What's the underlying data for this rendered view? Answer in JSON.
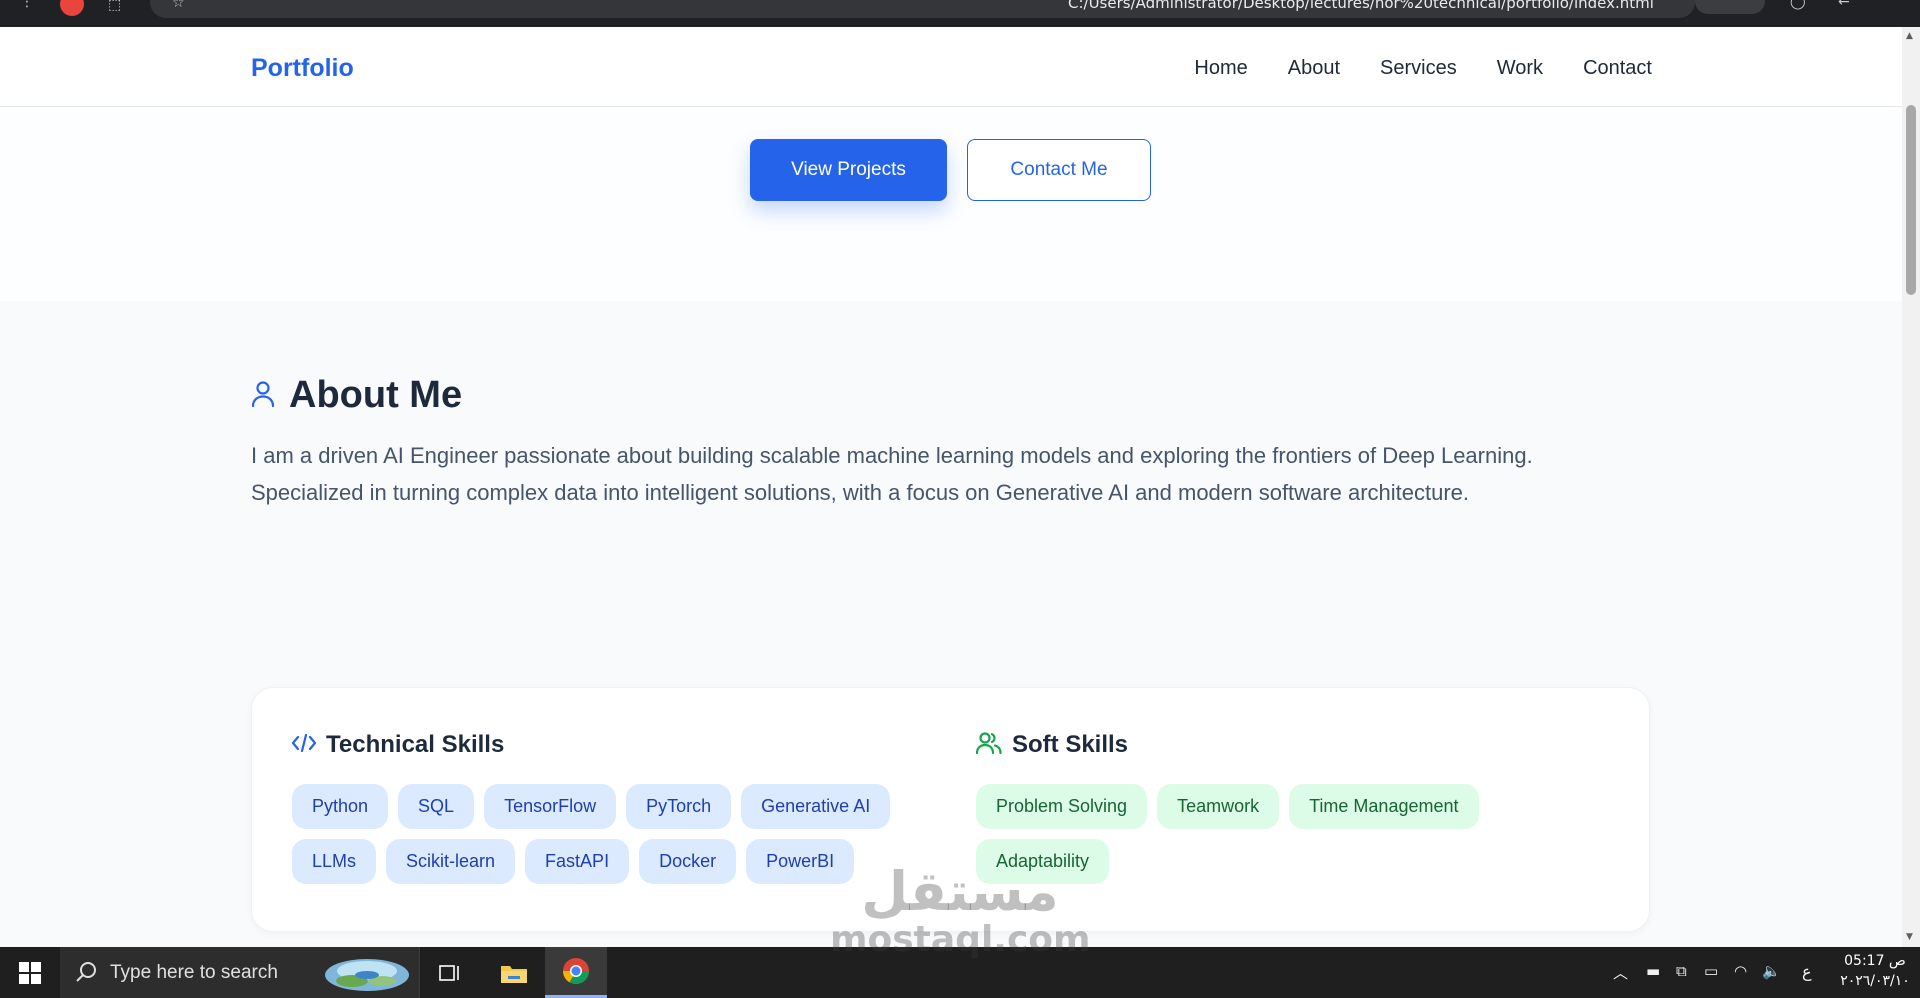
{
  "browser": {
    "url": "C:/Users/Administrator/Desktop/lectures/nor%20technical/portfolio/index.html"
  },
  "navbar": {
    "logo": "Portfolio",
    "links": [
      "Home",
      "About",
      "Services",
      "Work",
      "Contact"
    ]
  },
  "hero": {
    "primary_button": "View Projects",
    "secondary_button": "Contact Me"
  },
  "about": {
    "title": "About Me",
    "paragraph_line1": "I am a driven AI Engineer passionate about building scalable machine learning models and exploring the frontiers of Deep Learning.",
    "paragraph_line2": "Specialized in turning complex data into intelligent solutions, with a focus on Generative AI and modern software architecture.",
    "technical": {
      "title": "Technical Skills",
      "tags": [
        "Python",
        "SQL",
        "TensorFlow",
        "PyTorch",
        "Generative AI",
        "LLMs",
        "Scikit-learn",
        "FastAPI",
        "Docker",
        "PowerBI"
      ]
    },
    "soft": {
      "title": "Soft Skills",
      "tags": [
        "Problem Solving",
        "Teamwork",
        "Time Management",
        "Adaptability"
      ]
    }
  },
  "watermark": {
    "arabic": "مستقل",
    "latin": "mostaql.com"
  },
  "taskbar": {
    "search_placeholder": "Type here to search",
    "lang_indicator": "ع",
    "time": "05:17 ص",
    "date": "٢٠٢٦/٠٣/١٠"
  },
  "colors": {
    "accent": "#2563eb",
    "tag_blue_bg": "#dbeafe",
    "tag_green_bg": "#dcfce7",
    "heading": "#1e293b"
  }
}
